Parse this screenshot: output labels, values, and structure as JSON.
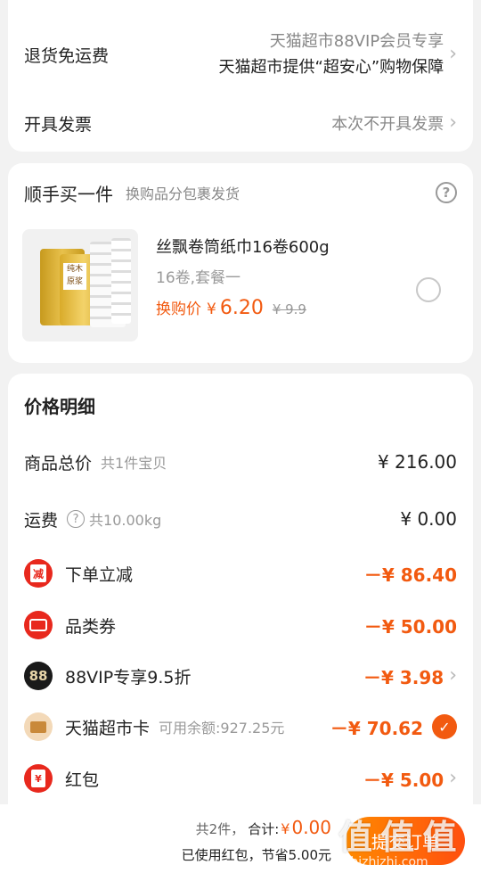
{
  "return_shipping": {
    "label": "退货免运费",
    "line1": "天猫超市88VIP会员专享",
    "line2": "天猫超市提供“超安心”购物保障"
  },
  "invoice": {
    "label": "开具发票",
    "value": "本次不开具发票"
  },
  "addon": {
    "title": "顺手买一件",
    "subtitle": "换购品分包裹发货",
    "product": {
      "name": "丝飘卷筒纸巾16卷600g",
      "spec": "16卷,套餐一",
      "price_label": "换购价",
      "currency": "¥",
      "price": "6.20",
      "original_price": "¥ 9.9",
      "pkg_brand": "丝飘",
      "pkg_text": "纯木\n原浆"
    }
  },
  "price_detail": {
    "title": "价格明细",
    "goods_total": {
      "label": "商品总价",
      "sub": "共1件宝贝",
      "value": "¥ 216.00"
    },
    "shipping": {
      "label": "运费",
      "sub": "共10.00kg",
      "value": "¥ 0.00"
    },
    "discounts": [
      {
        "icon_text": "减",
        "label": "下单立减",
        "value": "－¥ 86.40"
      },
      {
        "icon_text": "",
        "label": "品类券",
        "value": "－¥ 50.00"
      },
      {
        "icon_text": "88",
        "label": "88VIP专享9.5折",
        "value": "－¥ 3.98"
      },
      {
        "icon_text": "",
        "label": "天猫超市卡",
        "sub": "可用余额:927.25元",
        "value": "－¥ 70.62"
      },
      {
        "icon_text": "¥",
        "label": "红包",
        "value": "－¥ 5.00"
      }
    ]
  },
  "footer": {
    "count": "共2件，",
    "total_label": "合计:",
    "currency": "¥",
    "total_value": "0.00",
    "saved": "已使用红包，节省5.00元",
    "submit": "提交订单",
    "watermark": "值 值 值",
    "watermark_url": "zhizhizhi.com"
  },
  "colors": {
    "accent": "#f25a10",
    "red_icon": "#e8281d",
    "dark_icon": "#1a1a1a",
    "card_icon": "#f3d9b8"
  }
}
